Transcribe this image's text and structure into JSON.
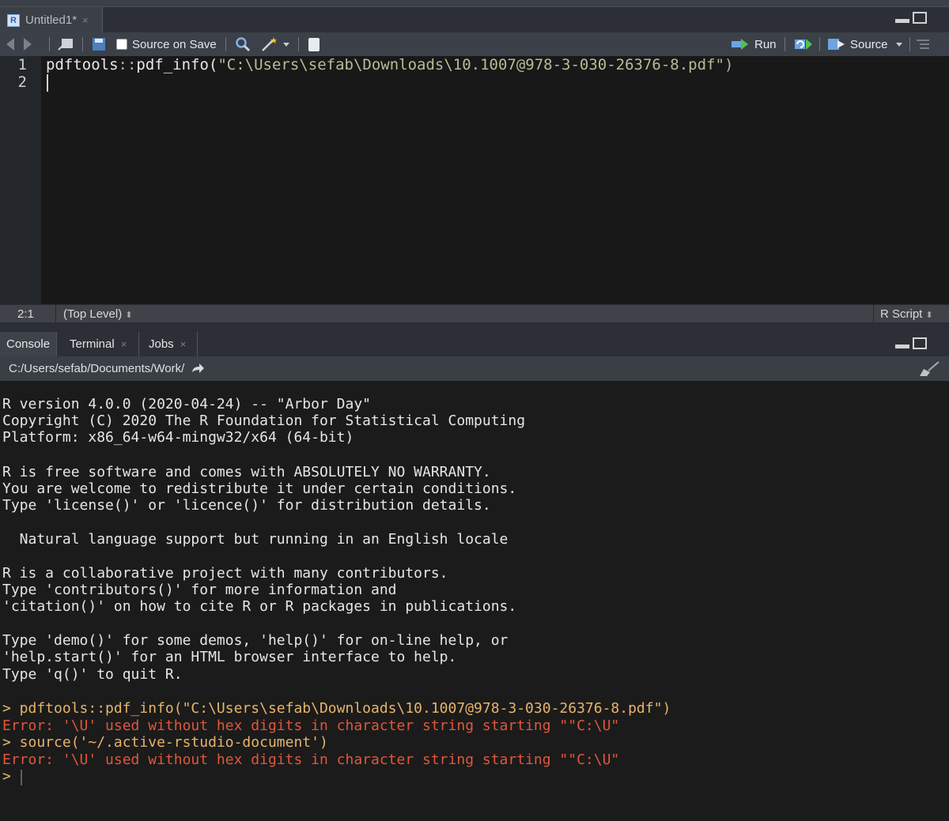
{
  "editor": {
    "tab": {
      "title": "Untitled1*",
      "close": "×",
      "icon": "r-script-icon"
    },
    "toolbar": {
      "source_on_save_label": "Source on Save",
      "run_label": "Run",
      "source_label": "Source"
    },
    "line_numbers": [
      "1",
      "2"
    ],
    "code": {
      "line1_ns": "pdftools",
      "line1_op": "::",
      "line1_fn": "pdf_info(",
      "line1_str": "\"C:\\Users\\sefab\\Downloads\\10.1007@978-3-030-26376-8.pdf\"",
      "line1_close": ")"
    },
    "status": {
      "position": "2:1",
      "scope": "(Top Level) ",
      "file_type": "R Script"
    }
  },
  "console": {
    "tabs": [
      {
        "label": "Console"
      },
      {
        "label": "Terminal",
        "close": "×"
      },
      {
        "label": "Jobs",
        "close": "×"
      }
    ],
    "working_dir": "C:/Users/sefab/Documents/Work/",
    "lines": [
      "R version 4.0.0 (2020-04-24) -- \"Arbor Day\"",
      "Copyright (C) 2020 The R Foundation for Statistical Computing",
      "Platform: x86_64-w64-mingw32/x64 (64-bit)",
      "R is free software and comes with ABSOLUTELY NO WARRANTY.",
      "You are welcome to redistribute it under certain conditions.",
      "Type 'license()' or 'licence()' for distribution details.",
      "  Natural language support but running in an English locale",
      "R is a collaborative project with many contributors.",
      "Type 'contributors()' for more information and",
      "'citation()' on how to cite R or R packages in publications.",
      "Type 'demo()' for some demos, 'help()' for on-line help, or",
      "'help.start()' for an HTML browser interface to help.",
      "Type 'q()' to quit R."
    ],
    "cmd1": "> pdftools::pdf_info(\"C:\\Users\\sefab\\Downloads\\10.1007@978-3-030-26376-8.pdf\")",
    "err1": "Error: '\\U' used without hex digits in character string starting \"\"C:\\U\"",
    "cmd2": "> source('~/.active-rstudio-document')",
    "err2": "Error: '\\U' used without hex digits in character string starting \"\"C:\\U\"",
    "prompt": ">"
  },
  "colors": {
    "accent_error": "#e0573a",
    "accent_command": "#e8b46a",
    "string_green": "#b3bf96"
  }
}
